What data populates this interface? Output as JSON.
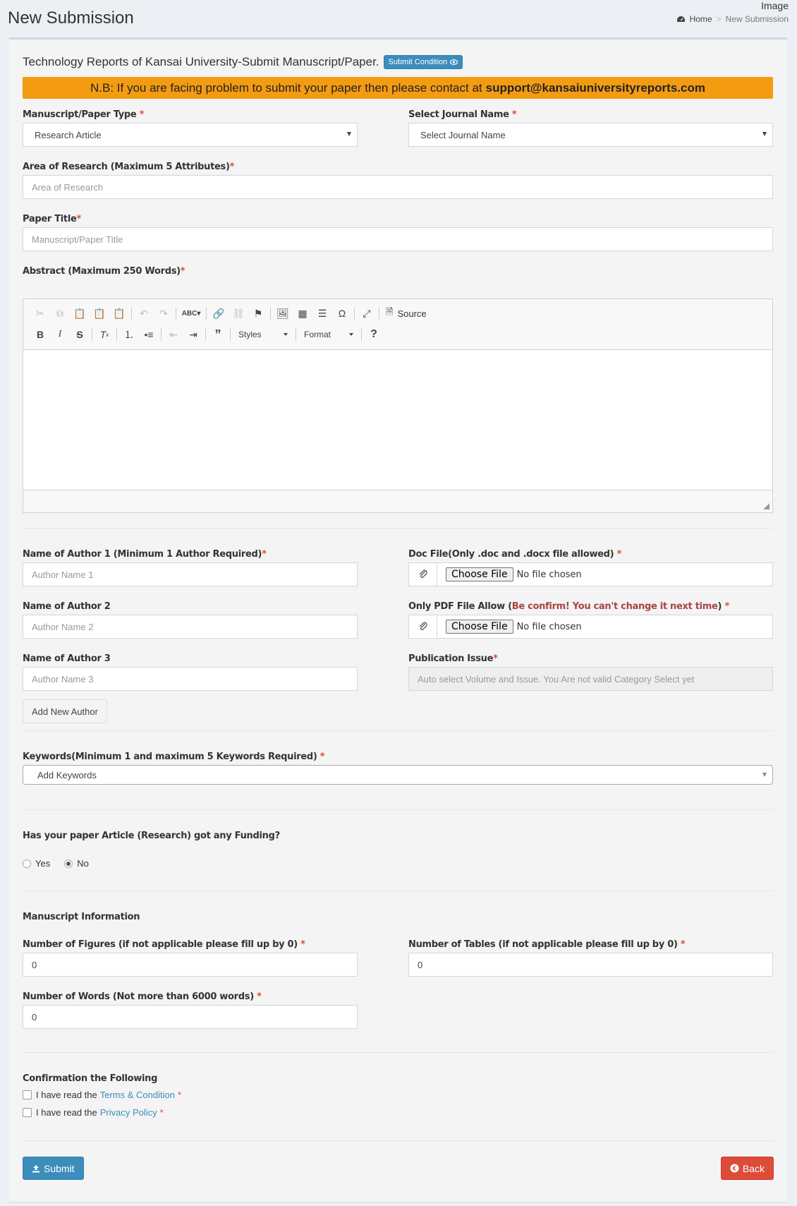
{
  "corner_label": "Image",
  "header": {
    "title": "New Submission"
  },
  "breadcrumb": {
    "home": "Home",
    "current": "New Submission"
  },
  "intro": {
    "text": "Technology Reports of Kansai University-Submit Manuscript/Paper.",
    "condition_button": "Submit Condition"
  },
  "notice": {
    "text": "N.B: If you are facing problem to submit your paper then please contact at",
    "email": "support@kansaiuniversityreports.com"
  },
  "form": {
    "paper_type": {
      "label": "Manuscript/Paper Type",
      "value": "Research Article"
    },
    "journal": {
      "label": "Select Journal Name",
      "value": "Select Journal Name"
    },
    "area": {
      "label": "Area of Research (Maximum 5 Attributes)",
      "placeholder": "Area of Research"
    },
    "title": {
      "label": "Paper Title",
      "placeholder": "Manuscript/Paper Title"
    },
    "abstract": {
      "label": "Abstract (Maximum 250 Words)"
    },
    "editor": {
      "source": "Source",
      "styles": "Styles",
      "format": "Format"
    },
    "author1": {
      "label": "Name of Author 1 (Minimum 1 Author Required)",
      "placeholder": "Author Name 1"
    },
    "author2": {
      "label": "Name of Author 2",
      "placeholder": "Author Name 2"
    },
    "author3": {
      "label": "Name of Author 3",
      "placeholder": "Author Name 3"
    },
    "add_author": "Add New Author",
    "doc_file": {
      "label": "Doc File(Only .doc and .docx file allowed)",
      "button": "Choose File",
      "status": "No file chosen"
    },
    "pdf_file": {
      "label_start": "Only PDF File Allow (",
      "warning": "Be confirm! You can't change it next time",
      "label_end": ")",
      "button": "Choose File",
      "status": "No file chosen"
    },
    "publication_issue": {
      "label": "Publication Issue",
      "value": "Auto select Volume and Issue. You Are not valid Category Select yet"
    },
    "keywords": {
      "label": "Keywords(Minimum 1 and maximum 5 Keywords Required)",
      "placeholder": "Add Keywords"
    },
    "funding": {
      "label": "Has your paper Article (Research) got any Funding?",
      "yes": "Yes",
      "no": "No",
      "selected": "No"
    },
    "manuscript_info": {
      "heading": "Manuscript Information"
    },
    "figures": {
      "label": "Number of Figures (if not applicable please fill up by 0)",
      "value": "0"
    },
    "tables": {
      "label": "Number of Tables (if not applicable please fill up by 0)",
      "value": "0"
    },
    "words": {
      "label": "Number of Words (Not more than 6000 words)",
      "value": "0"
    },
    "confirm": {
      "heading": "Confirmation the Following",
      "terms_prefix": "I have read the",
      "terms_link": "Terms & Condition",
      "privacy_prefix": "I have read the",
      "privacy_link": "Privacy Policy"
    },
    "submit": "Submit",
    "back": "Back"
  },
  "colors": {
    "primary": "#3c8dbc",
    "warning": "#f39c12",
    "danger": "#dd4b39"
  }
}
